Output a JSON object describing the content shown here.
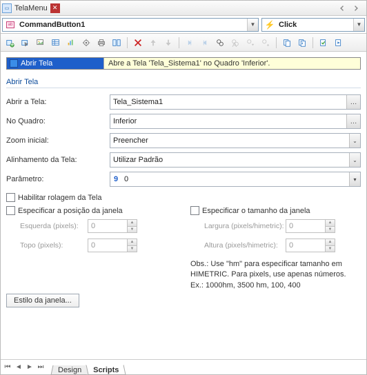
{
  "header": {
    "title": "TelaMenu"
  },
  "combos": {
    "object": "CommandButton1",
    "event": "Click"
  },
  "step": {
    "name": "Abrir Tela",
    "desc": "Abre a Tela 'Tela_Sistema1' no Quadro 'Inferior'."
  },
  "group": {
    "title": "Abrir Tela",
    "labels": {
      "tela": "Abrir a Tela:",
      "quadro": "No Quadro:",
      "zoom": "Zoom inicial:",
      "align": "Alinhamento da Tela:",
      "param": "Parâmetro:"
    },
    "values": {
      "tela": "Tela_Sistema1",
      "quadro": "Inferior",
      "zoom": "Preencher",
      "align": "Utilizar Padrão",
      "param": "0",
      "param_hint": "9"
    },
    "checks": {
      "scroll": "Habilitar rolagem da Tela",
      "pos": "Especificar a posição da janela",
      "size": "Especificar o tamanho da janela"
    },
    "sub": {
      "left": "Esquerda (pixels):",
      "top": "Topo (pixels):",
      "width": "Largura (pixels/himetric):",
      "height": "Altura (pixels/himetric):",
      "val": "0"
    },
    "note1": "Obs.: Use \"hm\" para especificar tamanho em",
    "note2": "HIMETRIC. Para pixels, use apenas números.",
    "note3": "Ex.: 1000hm, 3500 hm, 100, 400",
    "style_btn": "Estilo da janela..."
  },
  "footer": {
    "design": "Design",
    "scripts": "Scripts"
  }
}
